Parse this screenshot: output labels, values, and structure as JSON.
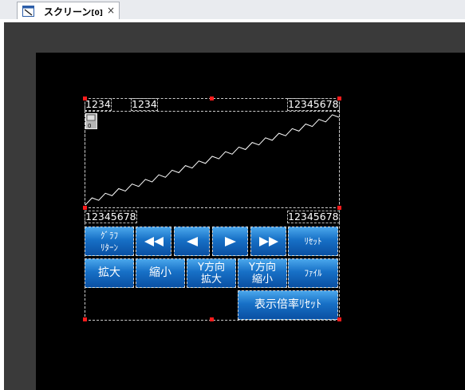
{
  "tab": {
    "title": "スクリーン",
    "suffix": "[0]",
    "close": "×"
  },
  "graph": {
    "top_left": "1234",
    "top_mid": "1234",
    "top_right": "12345678",
    "bottom_left": "12345678",
    "bottom_right": "12345678",
    "icon_label": "0"
  },
  "buttons": {
    "graph_return": [
      "ｸﾞﾗﾌ",
      "ﾘﾀｰﾝ"
    ],
    "rewind_fast": "rewind-fast-icon",
    "rewind": "rewind-icon",
    "forward": "forward-icon",
    "forward_fast": "forward-fast-icon",
    "reset": "ﾘｾｯﾄ",
    "zoom_in": "拡大",
    "zoom_out": "縮小",
    "y_zoom_in": [
      "Y方向",
      "拡大"
    ],
    "y_zoom_out": [
      "Y方向",
      "縮小"
    ],
    "file": "ﾌｧｲﾙ",
    "scale_reset": "表示倍率ﾘｾｯﾄ"
  },
  "colors": {
    "button_top": "#4aa7ec",
    "button_bottom": "#0a50a3",
    "handle": "#ff1c1c",
    "canvas": "#000000"
  }
}
